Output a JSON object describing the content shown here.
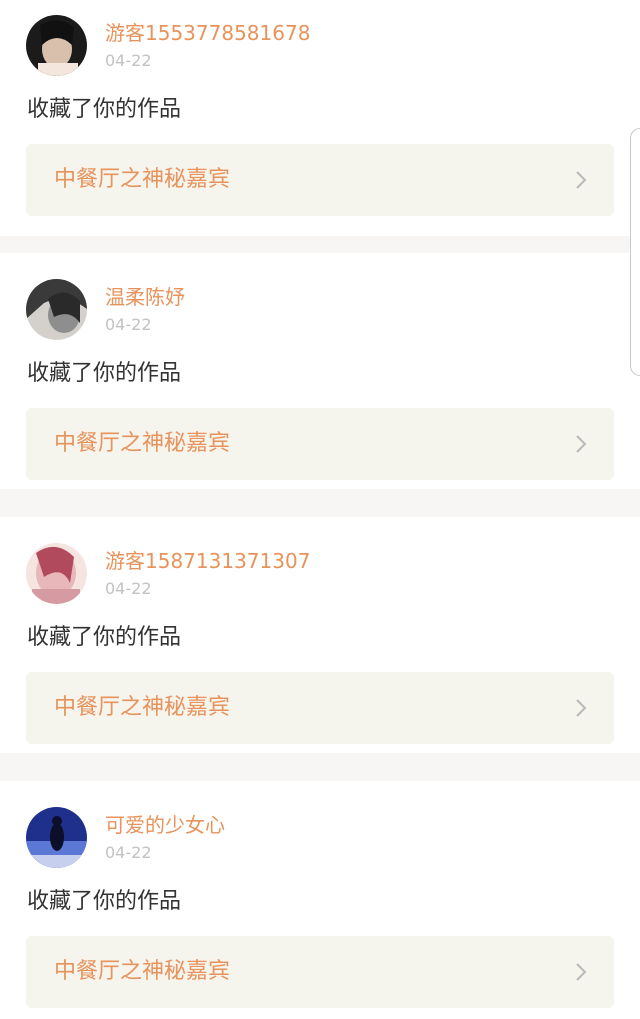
{
  "notifications": [
    {
      "username": "游客1553778581678",
      "date": "04-22",
      "action": "收藏了你的作品",
      "work_title": "中餐厅之神秘嘉宾",
      "avatar_colors": [
        "#1b1b1b",
        "#d8c0ac",
        "#f4e6dc"
      ]
    },
    {
      "username": "温柔陈妤",
      "date": "04-22",
      "action": "收藏了你的作品",
      "work_title": "中餐厅之神秘嘉宾",
      "avatar_colors": [
        "#3a3a3a",
        "#8e8e8e",
        "#d4d0cc"
      ]
    },
    {
      "username": "游客1587131371307",
      "date": "04-22",
      "action": "收藏了你的作品",
      "work_title": "中餐厅之神秘嘉宾",
      "avatar_colors": [
        "#b24a5e",
        "#e8b7b9",
        "#f5e4e0"
      ]
    },
    {
      "username": "可爱的少女心",
      "date": "04-22",
      "action": "收藏了你的作品",
      "work_title": "中餐厅之神秘嘉宾",
      "avatar_colors": [
        "#1f2f8c",
        "#5b78d6",
        "#c7cfee"
      ]
    }
  ],
  "colors": {
    "accent": "#e8935c",
    "text": "#333333",
    "muted": "#c2c2c2",
    "link_bg": "#f5f4ed",
    "separator": "#f7f6f4"
  }
}
